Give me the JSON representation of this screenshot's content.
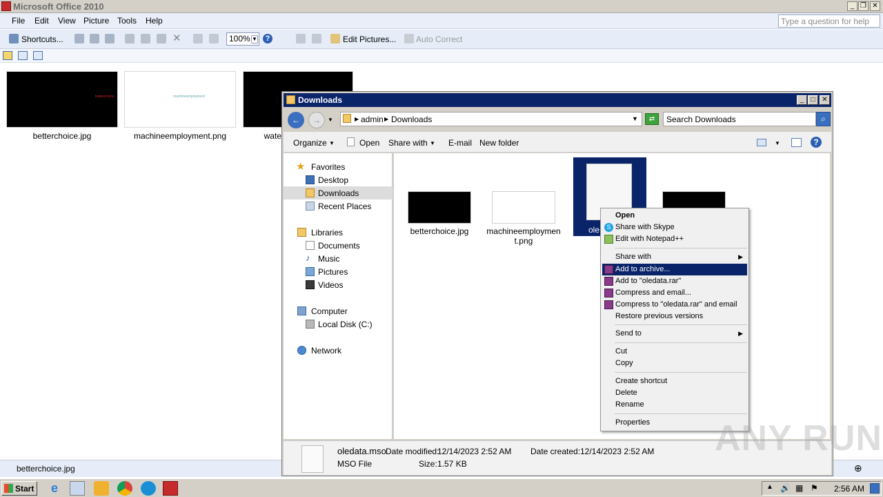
{
  "office": {
    "title": "Microsoft Office 2010",
    "menu": [
      "File",
      "Edit",
      "View",
      "Picture",
      "Tools",
      "Help"
    ],
    "help_placeholder": "Type a question for help",
    "toolbar": {
      "shortcuts": "Shortcuts...",
      "zoom": "100%",
      "edit_pictures": "Edit Pictures...",
      "auto_correct": "Auto Correct"
    },
    "thumbnails": [
      {
        "name": "betterchoice.jpg",
        "inner": "betterchoice"
      },
      {
        "name": "machineemployment.png",
        "inner": "machineemployment"
      },
      {
        "name": "wate",
        "inner": ""
      }
    ],
    "status": "betterchoice.jpg"
  },
  "explorer": {
    "title": "Downloads",
    "breadcrumb": [
      "admin",
      "Downloads"
    ],
    "search_placeholder": "Search Downloads",
    "commands": [
      "Organize",
      "Open",
      "Share with",
      "E-mail",
      "New folder"
    ],
    "nav": {
      "favorites": "Favorites",
      "desktop": "Desktop",
      "downloads": "Downloads",
      "recent": "Recent Places",
      "libraries": "Libraries",
      "documents": "Documents",
      "music": "Music",
      "pictures": "Pictures",
      "videos": "Videos",
      "computer": "Computer",
      "localdisk": "Local Disk (C:)",
      "network": "Network"
    },
    "files": [
      {
        "name": "betterchoice.jpg"
      },
      {
        "name_line1": "machineemploymen",
        "name_line2": "t.png"
      },
      {
        "name": "ole"
      }
    ],
    "details": {
      "filename": "oledata.mso",
      "type": "MSO File",
      "modified_label": "Date modified:",
      "modified": "12/14/2023 2:52 AM",
      "created_label": "Date created:",
      "created": "12/14/2023 2:52 AM",
      "size_label": "Size:",
      "size": "1.57 KB"
    }
  },
  "context_menu": {
    "open": "Open",
    "share_skype": "Share with Skype",
    "edit_notepad": "Edit with Notepad++",
    "share_with": "Share with",
    "add_archive": "Add to archive...",
    "add_rar": "Add to \"oledata.rar\"",
    "compress_email": "Compress and email...",
    "compress_rar_email": "Compress to \"oledata.rar\" and email",
    "restore": "Restore previous versions",
    "send_to": "Send to",
    "cut": "Cut",
    "copy": "Copy",
    "create_shortcut": "Create shortcut",
    "delete": "Delete",
    "rename": "Rename",
    "properties": "Properties"
  },
  "taskbar": {
    "start": "Start",
    "clock": "2:56 AM"
  },
  "watermark": "ANY RUN"
}
